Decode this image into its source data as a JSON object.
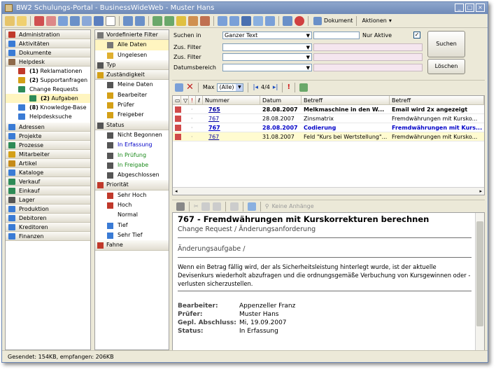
{
  "window": {
    "title": "BW2 Schulungs-Portal - BusinessWideWeb - Muster Hans"
  },
  "toolbar": {
    "dokument_label": "Dokument",
    "aktionen_label": "Aktionen"
  },
  "nav": {
    "items": [
      {
        "label": "Administration",
        "level": 0,
        "icon_color": "#c0392b"
      },
      {
        "label": "Aktivitäten",
        "level": 0,
        "icon_color": "#3a7bd5"
      },
      {
        "label": "Dokumente",
        "level": 0,
        "icon_color": "#3a7bd5"
      },
      {
        "label": "Helpdesk",
        "level": 0,
        "icon_color": "#8e6a4a"
      },
      {
        "label": "Reklamationen",
        "count": "(1)",
        "level": 1,
        "icon_color": "#c0392b"
      },
      {
        "label": "Supportanfragen",
        "count": "(2)",
        "level": 1,
        "icon_color": "#d4a017"
      },
      {
        "label": "Change Requests",
        "level": 1,
        "icon_color": "#2e8b57"
      },
      {
        "label": "Aufgaben",
        "count": "(2)",
        "level": 2,
        "icon_color": "#2e8b57"
      },
      {
        "label": "Knowledge-Base",
        "count": "(8)",
        "level": 1,
        "icon_color": "#3a7bd5"
      },
      {
        "label": "Helpdesksuche",
        "level": 1,
        "icon_color": "#3a7bd5"
      },
      {
        "label": "Adressen",
        "level": 0,
        "icon_color": "#3a7bd5"
      },
      {
        "label": "Projekte",
        "level": 0,
        "icon_color": "#3a7bd5"
      },
      {
        "label": "Prozesse",
        "level": 0,
        "icon_color": "#2e8b57"
      },
      {
        "label": "Mitarbeiter",
        "level": 0,
        "icon_color": "#d4a017"
      },
      {
        "label": "Artikel",
        "level": 0,
        "icon_color": "#c58a17"
      },
      {
        "label": "Kataloge",
        "level": 0,
        "icon_color": "#3a7bd5"
      },
      {
        "label": "Verkauf",
        "level": 0,
        "icon_color": "#2e8b57"
      },
      {
        "label": "Einkauf",
        "level": 0,
        "icon_color": "#2e8b57"
      },
      {
        "label": "Lager",
        "level": 0,
        "icon_color": "#555555"
      },
      {
        "label": "Produktion",
        "level": 0,
        "icon_color": "#3a7bd5"
      },
      {
        "label": "Debitoren",
        "level": 0,
        "icon_color": "#3a7bd5"
      },
      {
        "label": "Kreditoren",
        "level": 0,
        "icon_color": "#3a7bd5"
      },
      {
        "label": "Finanzen",
        "level": 0,
        "icon_color": "#3a7bd5"
      }
    ]
  },
  "filter": {
    "items": [
      {
        "label": "Vordefinierte Filter",
        "head": true,
        "icon_color": "#777777"
      },
      {
        "label": "Alle Daten",
        "icon_color": "#777777",
        "selected": true
      },
      {
        "label": "Ungelesen",
        "icon_color": "#e0b030"
      },
      {
        "label": "Typ",
        "head": true,
        "icon_color": "#555555"
      },
      {
        "label": "Zuständigkeit",
        "head": true,
        "icon_color": "#d4a017"
      },
      {
        "label": "Meine Daten",
        "icon_color": "#555555"
      },
      {
        "label": "Bearbeiter",
        "icon_color": "#d4a017"
      },
      {
        "label": "Prüfer",
        "icon_color": "#d4a017"
      },
      {
        "label": "Freigeber",
        "icon_color": "#d4a017"
      },
      {
        "label": "Status",
        "head": true,
        "icon_color": "#555555"
      },
      {
        "label": "Nicht Begonnen",
        "icon_color": "#555555"
      },
      {
        "label": "In Erfassung",
        "icon_color": "#555555",
        "color": "blue"
      },
      {
        "label": "In Prüfung",
        "icon_color": "#555555",
        "color": "green"
      },
      {
        "label": "In Freigabe",
        "icon_color": "#555555",
        "color": "green"
      },
      {
        "label": "Abgeschlossen",
        "icon_color": "#555555"
      },
      {
        "label": "Priorität",
        "head": true,
        "icon_color": "#c0392b"
      },
      {
        "label": "Sehr Hoch",
        "icon_color": "#c0392b"
      },
      {
        "label": "Hoch",
        "icon_color": "#c0392b"
      },
      {
        "label": "Normal",
        "icon_color": "#ffffff"
      },
      {
        "label": "Tief",
        "icon_color": "#3a7bd5"
      },
      {
        "label": "Sehr Tief",
        "icon_color": "#3a7bd5"
      },
      {
        "label": "Fahne",
        "head": true,
        "icon_color": "#c0392b"
      }
    ]
  },
  "search": {
    "suchen_in_label": "Suchen in",
    "suchen_in_value": "Ganzer Text",
    "nur_aktive_label": "Nur Aktive",
    "nur_aktive_checked": true,
    "zus_filter_label": "Zus. Filter",
    "datumsbereich_label": "Datumsbereich",
    "suchen_button": "Suchen",
    "loeschen_button": "Löschen"
  },
  "list": {
    "max_label": "Max",
    "max_value": "(Alle)",
    "page_info": "4/4",
    "columns": [
      "Nummer",
      "Datum",
      "Betreff",
      "Betreff"
    ],
    "rows": [
      {
        "nummer": "765",
        "datum": "28.08.2007",
        "betreff1": "Melkmaschine in den W...",
        "betreff2": "Email wird 2x angezeigt",
        "style": "bold"
      },
      {
        "nummer": "767",
        "datum": "28.08.2007",
        "betreff1": "Zinsmatrix",
        "betreff2": "Fremdwährungen mit Kursko...",
        "style": "normal"
      },
      {
        "nummer": "767",
        "datum": "28.08.2007",
        "betreff1": "Codierung",
        "betreff2": "Fremdwährungen mit Kurs...",
        "style": "boldblue"
      },
      {
        "nummer": "767",
        "datum": "31.08.2007",
        "betreff1": "Feld \"Kurs bei Wertstellung\"...",
        "betreff2": "Fremdwährungen mit Kursko...",
        "style": "selected"
      }
    ]
  },
  "detail_toolbar": {
    "attachments_label": "Keine Anhänge"
  },
  "detail": {
    "title": "767 - Fremdwährungen mit Kurskorrekturen berechnen",
    "subtitle": "Change Request / Änderungsanforderung",
    "section": "Änderungsaufgabe /",
    "text": "Wenn ein Betrag fällig wird, der als Sicherheitsleistung hinterlegt wurde, ist der aktuelle Devisenkurs wiederholt abzufragen und die ordnungsgemäße Verbuchung von Kursgewinnen oder -verlusten sicherzustellen.",
    "fields": [
      {
        "key": "Bearbeiter:",
        "value": "Appenzeller Franz"
      },
      {
        "key": "Prüfer:",
        "value": "Muster Hans"
      },
      {
        "key": "Gepl. Abschluss:",
        "value": "Mi, 19.09.2007"
      },
      {
        "key": "Status:",
        "value": "In Erfassung"
      }
    ]
  },
  "status": {
    "text": "Gesendet: 154KB, empfangen: 206KB"
  }
}
